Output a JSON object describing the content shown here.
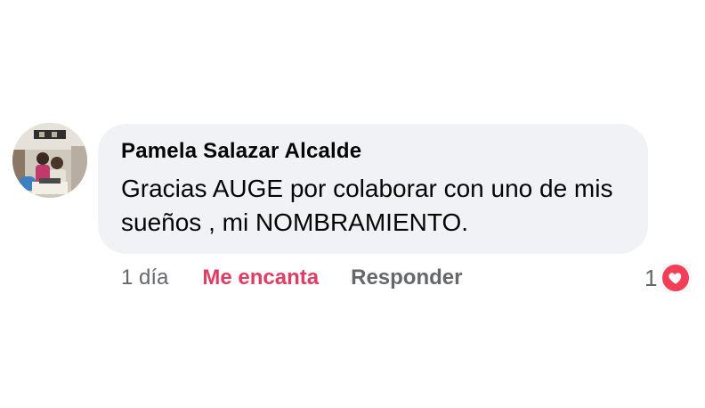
{
  "comment": {
    "author": "Pamela Salazar Alcalde",
    "text": "Gracias AUGE por colaborar con uno de mis sueños , mi NOMBRAMIENTO.",
    "time": "1 día",
    "love_label": "Me encanta",
    "reply_label": "Responder",
    "reaction_count": "1",
    "reaction_icon": "heart-icon",
    "avatar_icon": "profile-photo"
  },
  "colors": {
    "bubble_bg": "#f0f2f5",
    "love_active": "#e13d62",
    "muted": "#65676b",
    "heart_badge": "#f33e58"
  }
}
